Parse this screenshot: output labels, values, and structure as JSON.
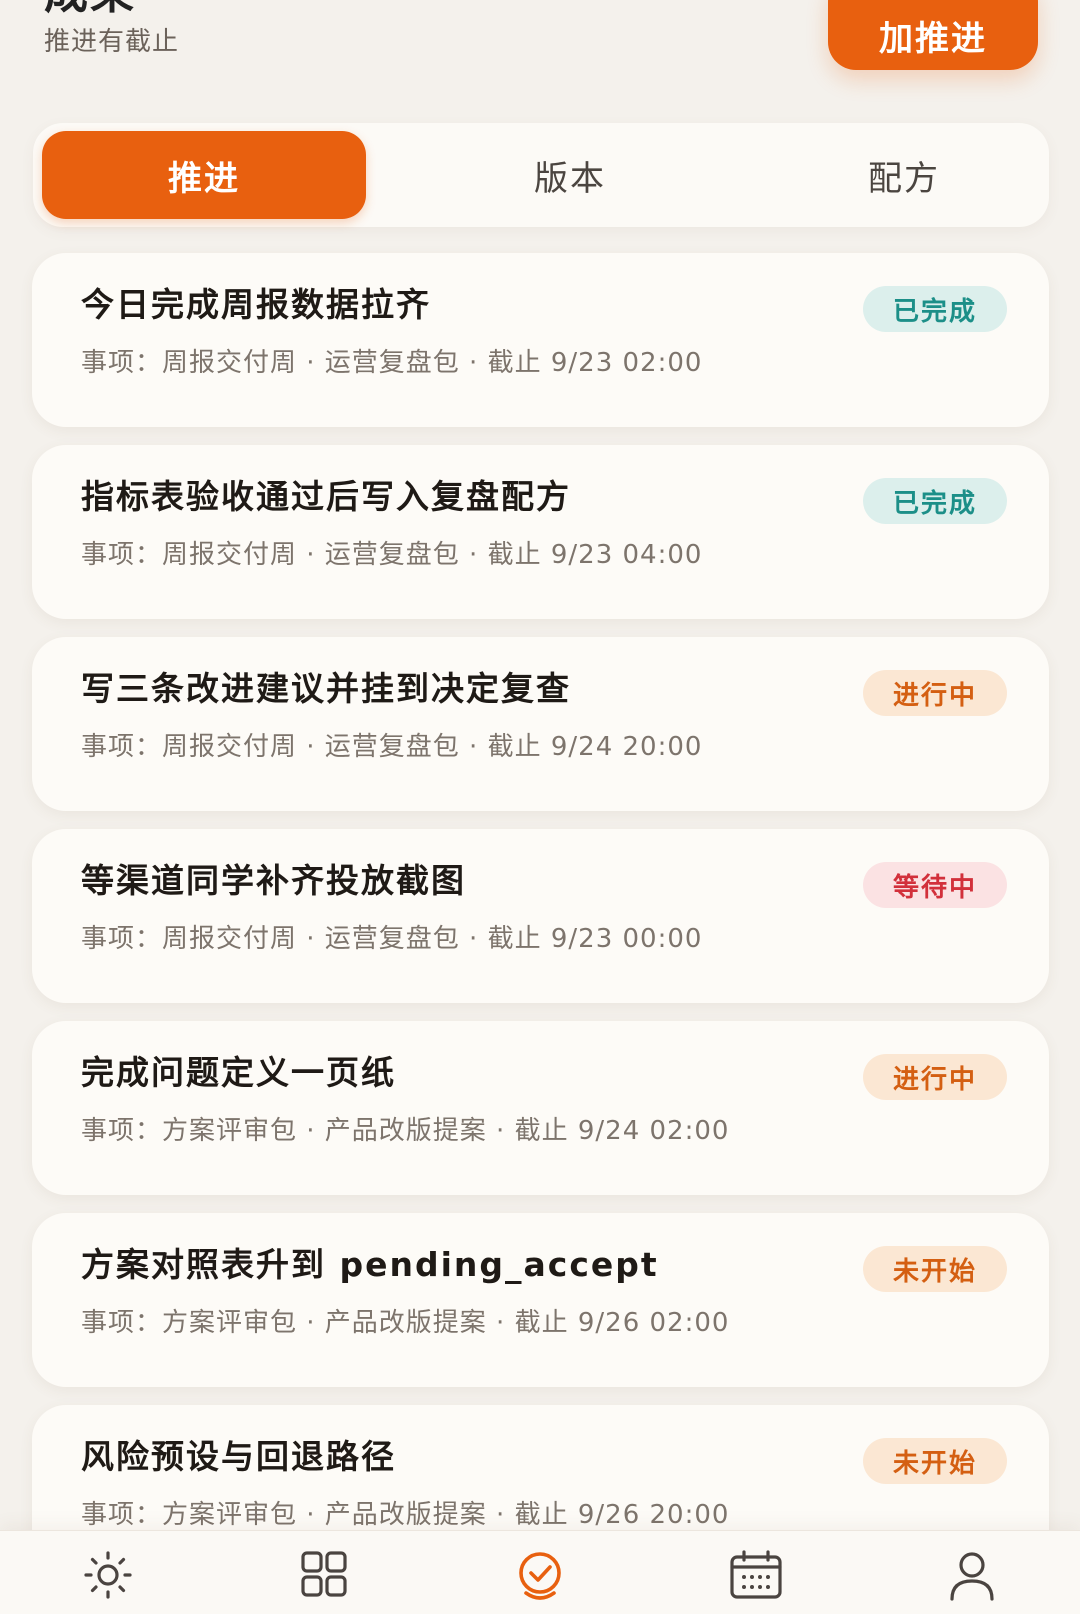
{
  "header": {
    "title": "成果",
    "subtitle": "推进有截止",
    "add_button_label": "加推进"
  },
  "tabs": [
    {
      "label": "推进",
      "active": true
    },
    {
      "label": "版本",
      "active": false
    },
    {
      "label": "配方",
      "active": false
    }
  ],
  "tasks": [
    {
      "title": "今日完成周报数据拉齐",
      "meta": "事项：周报交付周 · 运营复盘包 · 截止 9/23 02:00",
      "status": "已完成"
    },
    {
      "title": "指标表验收通过后写入复盘配方",
      "meta": "事项：周报交付周 · 运营复盘包 · 截止 9/23 04:00",
      "status": "已完成"
    },
    {
      "title": "写三条改进建议并挂到决定复查",
      "meta": "事项：周报交付周 · 运营复盘包 · 截止 9/24 20:00",
      "status": "进行中"
    },
    {
      "title": "等渠道同学补齐投放截图",
      "meta": "事项：周报交付周 · 运营复盘包 · 截止 9/23 00:00",
      "status": "等待中"
    },
    {
      "title": "完成问题定义一页纸",
      "meta": "事项：方案评审包 · 产品改版提案 · 截止 9/24 02:00",
      "status": "进行中"
    },
    {
      "title": "方案对照表升到 pending_accept",
      "meta": "事项：方案评审包 · 产品改版提案 · 截止 9/26 02:00",
      "status": "未开始"
    },
    {
      "title": "风险预设与回退路径",
      "meta": "事项：方案评审包 · 产品改版提案 · 截止 9/26 20:00",
      "status": "未开始"
    }
  ],
  "status_colors": {
    "已完成": "#1c8f88",
    "进行中": "#d45f12",
    "等待中": "#d2303b",
    "未开始": "#d45f12"
  },
  "accent_color": "#e8600f",
  "bottom_nav": [
    {
      "icon": "sun-icon",
      "active": false
    },
    {
      "icon": "grid-icon",
      "active": false
    },
    {
      "icon": "check-badge-icon",
      "active": true
    },
    {
      "icon": "calendar-icon",
      "active": false
    },
    {
      "icon": "user-icon",
      "active": false
    }
  ]
}
